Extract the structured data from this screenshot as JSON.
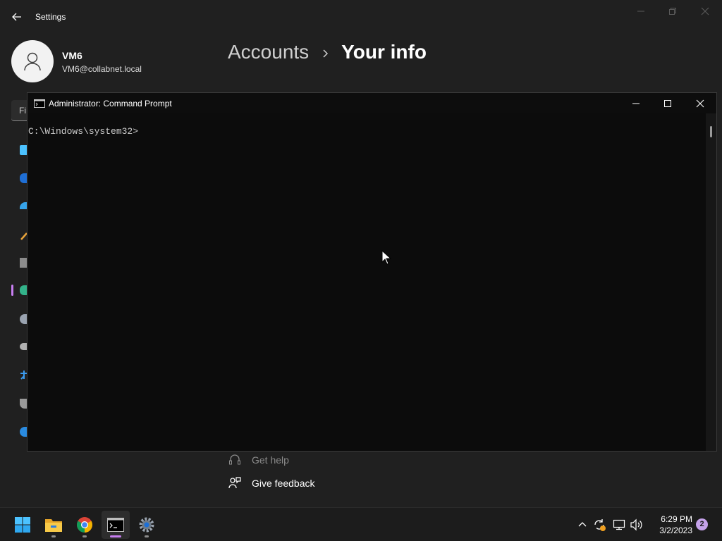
{
  "settings": {
    "title": "Settings",
    "user": {
      "name": "VM6",
      "email": "VM6@collabnet.local"
    },
    "breadcrumb": {
      "parent": "Accounts",
      "separator": "›",
      "current": "Your info"
    },
    "search_placeholder": "Fi",
    "nav_icons": [
      "system-icon",
      "bluetooth-icon",
      "network-icon",
      "personalization-icon",
      "apps-icon",
      "accounts-icon",
      "time-language-icon",
      "gaming-icon",
      "accessibility-icon",
      "privacy-security-icon",
      "windows-update-icon"
    ],
    "help": {
      "get_help": "Get help",
      "give_feedback": "Give feedback"
    }
  },
  "cmd": {
    "title": "Administrator:  Command Prompt",
    "prompt": "C:\\Windows\\system32>"
  },
  "taskbar": {
    "apps": [
      "start-button",
      "file-explorer",
      "chrome",
      "command-prompt",
      "settings"
    ],
    "active_app": "command-prompt",
    "clock": {
      "time": "6:29 PM",
      "date": "3/2/2023"
    },
    "notification_count": "2"
  },
  "colors": {
    "accent": "#c77ef0",
    "window_bg": "#202020",
    "console_bg": "#0c0c0c",
    "taskbar_bg": "#1c1c1c"
  }
}
